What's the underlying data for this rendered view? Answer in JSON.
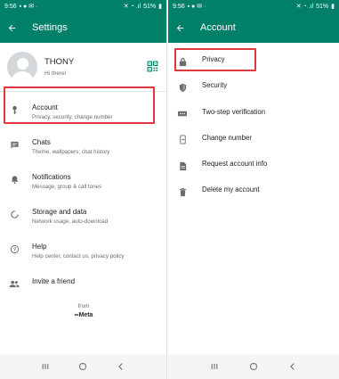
{
  "colors": {
    "primary": "#008069",
    "highlight": "#e0383e",
    "text": "#202124",
    "subtext": "#6b6b6b"
  },
  "status_bar": {
    "time": "9:56",
    "battery": "51%"
  },
  "settings": {
    "title": "Settings",
    "profile": {
      "name": "THONY",
      "status": "Hi there!"
    },
    "items": [
      {
        "label": "Account",
        "sub": "Privacy, security, change number",
        "icon": "key-icon"
      },
      {
        "label": "Chats",
        "sub": "Theme, wallpapers, chat history",
        "icon": "chat-icon"
      },
      {
        "label": "Notifications",
        "sub": "Message, group & call tones",
        "icon": "bell-icon"
      },
      {
        "label": "Storage and data",
        "sub": "Network usage, auto-download",
        "icon": "storage-icon"
      },
      {
        "label": "Help",
        "sub": "Help center, contact us, privacy policy",
        "icon": "help-icon"
      },
      {
        "label": "Invite a friend",
        "icon": "people-icon"
      }
    ],
    "from": "from",
    "brand": "∞Meta"
  },
  "account": {
    "title": "Account",
    "items": [
      {
        "label": "Privacy",
        "icon": "lock-icon"
      },
      {
        "label": "Security",
        "icon": "shield-icon"
      },
      {
        "label": "Two-step verification",
        "icon": "dots-icon"
      },
      {
        "label": "Change number",
        "icon": "phone-icon"
      },
      {
        "label": "Request account info",
        "icon": "document-icon"
      },
      {
        "label": "Delete my account",
        "icon": "trash-icon"
      }
    ]
  }
}
